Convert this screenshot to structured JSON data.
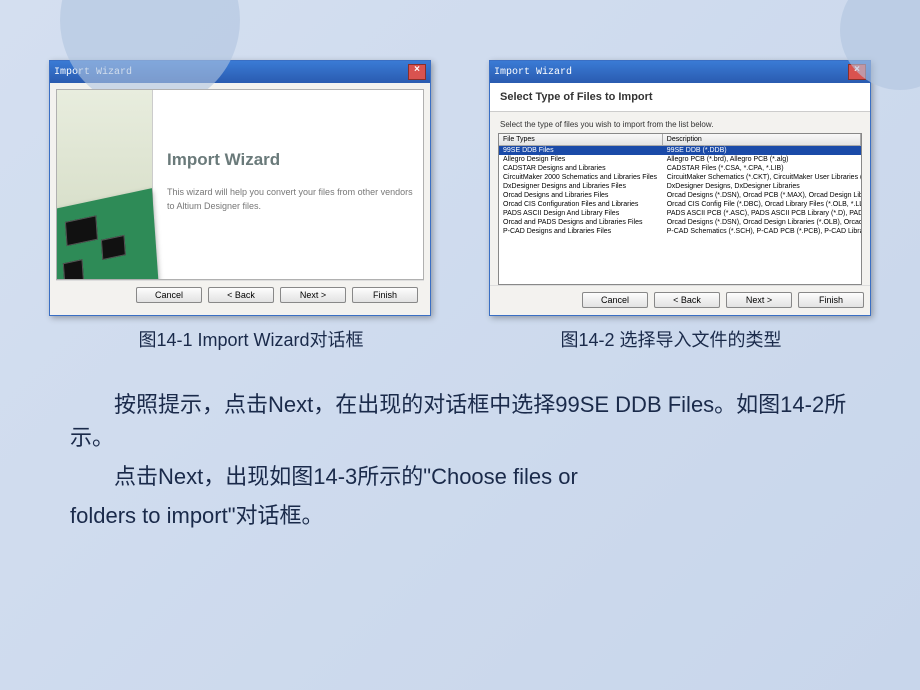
{
  "dialog1": {
    "title": "Import Wizard",
    "heading": "Import Wizard",
    "text": "This wizard will help you convert your files from other vendors to Altium Designer files.",
    "buttons": {
      "cancel": "Cancel",
      "back": "< Back",
      "next": "Next >",
      "finish": "Finish"
    }
  },
  "dialog2": {
    "title": "Import Wizard",
    "header": "Select Type of Files to Import",
    "prompt": "Select the type of files you wish to import from the list below.",
    "columns": {
      "c1": "File Types",
      "c2": "Description"
    },
    "rows": [
      {
        "t": "99SE DDB Files",
        "d": "99SE DDB (*.DDB)",
        "sel": true
      },
      {
        "t": "Allegro Design Files",
        "d": "Allegro PCB (*.brd), Allegro PCB (*.alg)"
      },
      {
        "t": "CADSTAR Designs and Libraries",
        "d": "CADSTAR Files (*.CSA, *.CPA, *.LIB)"
      },
      {
        "t": "CircuitMaker 2000 Schematics and Libraries Files",
        "d": "CircuitMaker Schematics (*.CKT), CircuitMaker User Libraries (*.LIB"
      },
      {
        "t": "DxDesigner Designs and Libraries Files",
        "d": "DxDesigner Designs, DxDesigner Libraries"
      },
      {
        "t": "Orcad Designs and Libraries Files",
        "d": "Orcad Designs (*.DSN), Orcad PCB (*.MAX), Orcad Design Librar"
      },
      {
        "t": "Orcad CIS Configuration Files and Libraries",
        "d": "Orcad CIS Config File (*.DBC), Orcad Library Files (*.OLB, *.LLB)"
      },
      {
        "t": "PADS ASCII Design And Library Files",
        "d": "PADS ASCII PCB (*.ASC), PADS ASCII PCB Library (*.D), PADS AS"
      },
      {
        "t": "Orcad and PADS Designs and Libraries Files",
        "d": "Orcad Designs (*.DSN), Orcad Design Libraries (*.OLB), Orcad P"
      },
      {
        "t": "P-CAD Designs and Libraries Files",
        "d": "P-CAD Schematics (*.SCH), P-CAD PCB (*.PCB), P-CAD Libraries (*"
      }
    ],
    "buttons": {
      "cancel": "Cancel",
      "back": "< Back",
      "next": "Next >",
      "finish": "Finish"
    }
  },
  "captions": {
    "c1": "图14-1 Import Wizard对话框",
    "c2": "图14-2 选择导入文件的类型"
  },
  "text": {
    "p1": "按照提示，点击Next，在出现的对话框中选择99SE DDB Files。如图14-2所示。",
    "p2a": "点击Next，出现如图14-3所示的\"Choose files or",
    "p2b": "folders to import\"对话框。"
  }
}
